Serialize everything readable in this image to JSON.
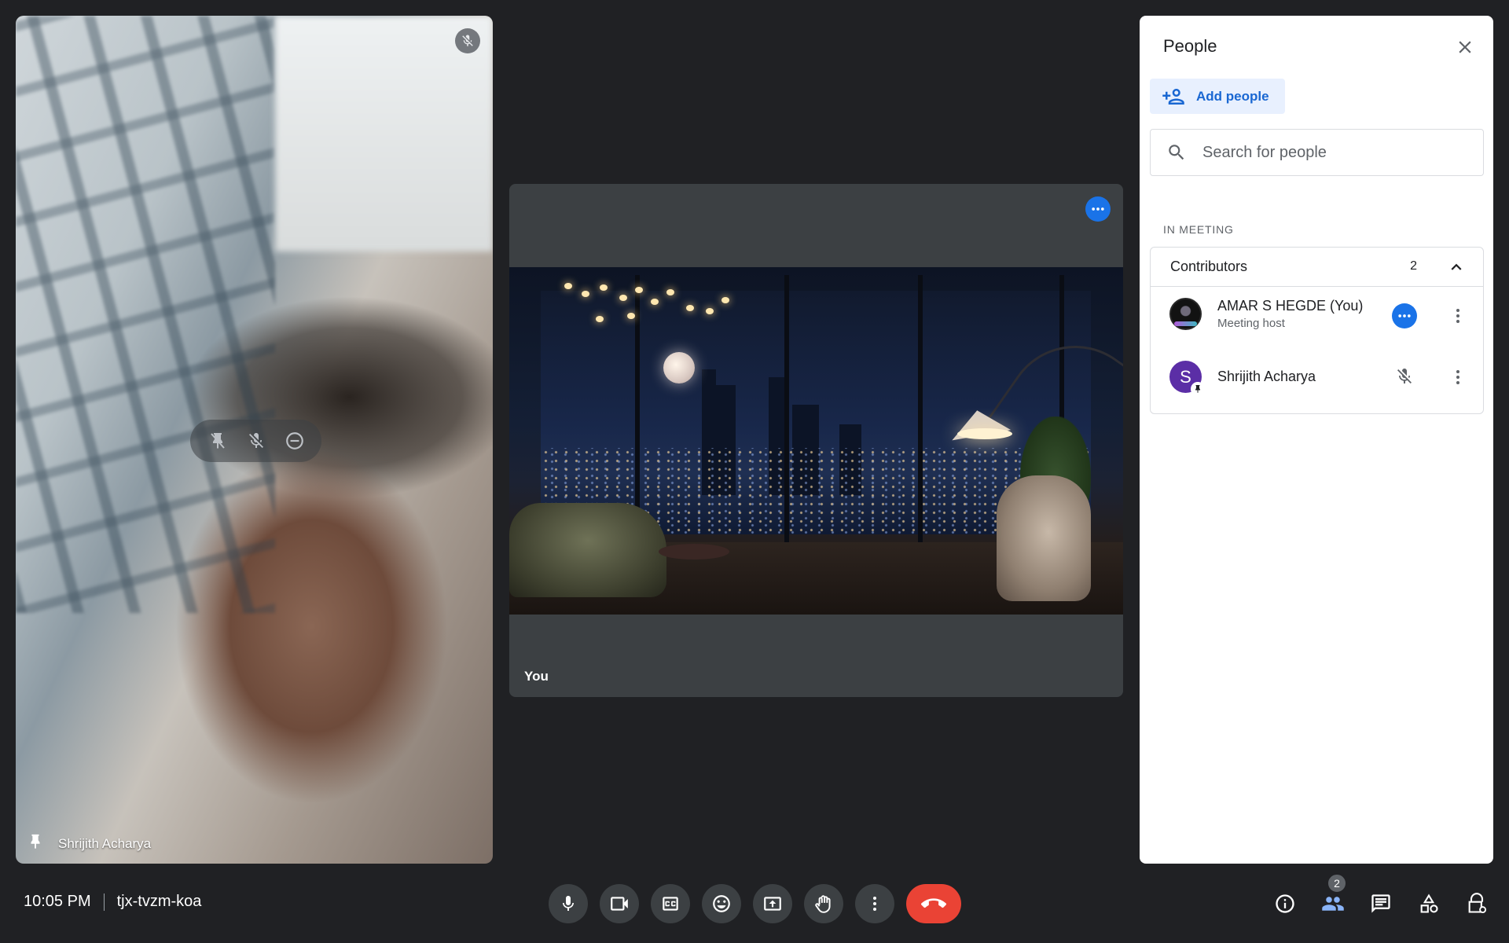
{
  "remote_tile": {
    "name": "Shrijith Acharya",
    "muted_icon": "mic-off-icon",
    "hover_controls": [
      "unpin-icon",
      "mic-off-icon",
      "remove-icon"
    ],
    "pin_icon": "pin-icon"
  },
  "self_tile": {
    "label": "You",
    "more_icon": "more-horizontal-icon"
  },
  "people_panel": {
    "title": "People",
    "close_icon": "close-icon",
    "add_people_label": "Add people",
    "search_placeholder": "Search for people",
    "section_heading": "IN MEETING",
    "group": {
      "label": "Contributors",
      "count": "2",
      "toggle_icon": "chevron-up-icon"
    },
    "participants": [
      {
        "name": "AMAR S HEGDE (You)",
        "role": "Meeting host",
        "action_icon": "more-horizontal-icon",
        "accent_color": "#1a73e8"
      },
      {
        "name": "Shrijith Acharya",
        "initial": "S",
        "action_icon": "mic-off-icon",
        "avatar_color": "#5b2ea6"
      }
    ]
  },
  "bottom_bar": {
    "time": "10:05 PM",
    "meeting_code": "tjx-tvzm-koa",
    "controls": [
      "mic-icon",
      "camera-icon",
      "captions-icon",
      "emoji-icon",
      "present-icon",
      "raise-hand-icon",
      "more-vert-icon",
      "end-call-icon"
    ],
    "right_controls": [
      "info-icon",
      "people-icon",
      "chat-icon",
      "activities-icon",
      "host-controls-icon"
    ],
    "people_count": "2",
    "end_call_color": "#ea4335"
  }
}
